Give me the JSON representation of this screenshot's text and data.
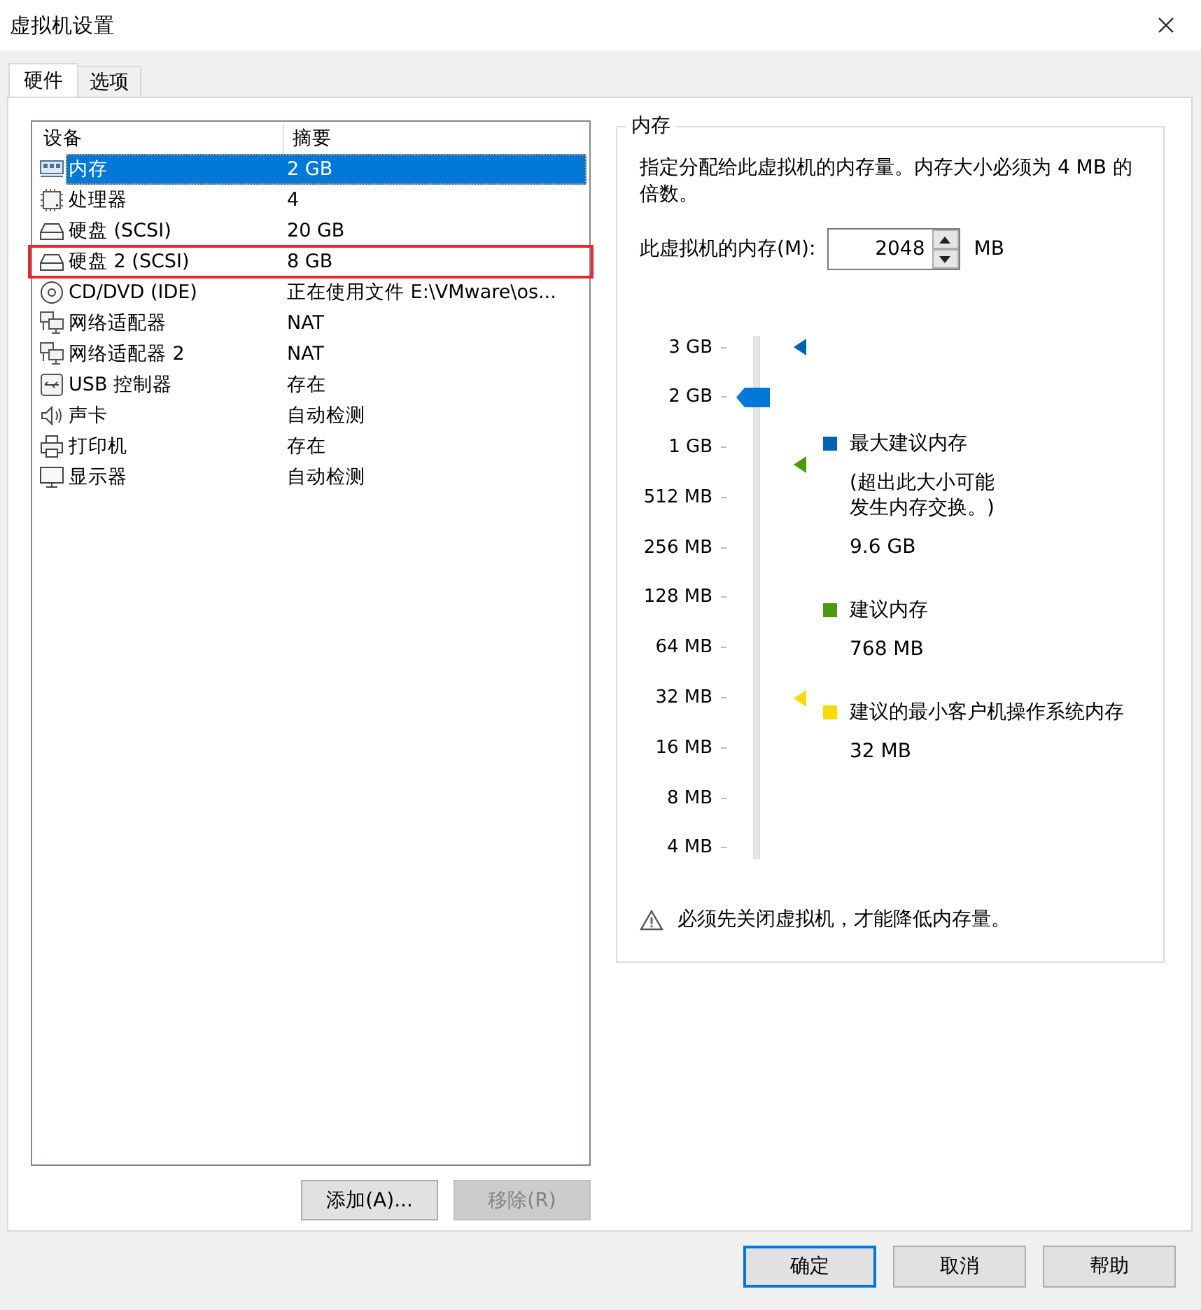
{
  "window": {
    "title": "虚拟机设置"
  },
  "tabs": [
    {
      "label": "硬件",
      "selected": true
    },
    {
      "label": "选项",
      "selected": false
    }
  ],
  "devices": {
    "columns": [
      "设备",
      "摘要"
    ],
    "rows": [
      {
        "kind": "memory",
        "name": "内存",
        "summary": "2 GB",
        "selected": true,
        "highlighted": false
      },
      {
        "kind": "cpu",
        "name": "处理器",
        "summary": "4",
        "selected": false,
        "highlighted": false
      },
      {
        "kind": "disk",
        "name": "硬盘 (SCSI)",
        "summary": "20 GB",
        "selected": false,
        "highlighted": false
      },
      {
        "kind": "disk",
        "name": "硬盘 2 (SCSI)",
        "summary": "8 GB",
        "selected": false,
        "highlighted": true
      },
      {
        "kind": "cdrom",
        "name": "CD/DVD (IDE)",
        "summary": "正在使用文件 E:\\VMware\\os...",
        "selected": false,
        "highlighted": false
      },
      {
        "kind": "network",
        "name": "网络适配器",
        "summary": "NAT",
        "selected": false,
        "highlighted": false
      },
      {
        "kind": "network",
        "name": "网络适配器 2",
        "summary": "NAT",
        "selected": false,
        "highlighted": false
      },
      {
        "kind": "usb",
        "name": "USB 控制器",
        "summary": "存在",
        "selected": false,
        "highlighted": false
      },
      {
        "kind": "sound",
        "name": "声卡",
        "summary": "自动检测",
        "selected": false,
        "highlighted": false
      },
      {
        "kind": "printer",
        "name": "打印机",
        "summary": "存在",
        "selected": false,
        "highlighted": false
      },
      {
        "kind": "display",
        "name": "显示器",
        "summary": "自动检测",
        "selected": false,
        "highlighted": false
      }
    ]
  },
  "list_buttons": [
    {
      "label": "添加(A)...",
      "disabled": false
    },
    {
      "label": "移除(R)",
      "disabled": true
    }
  ],
  "memory": {
    "title": "内存",
    "description": "指定分配给此虚拟机的内存量。内存大小必须为 4 MB 的倍数。",
    "field_label": "此虚拟机的内存(M):",
    "value": "2048",
    "unit": "MB",
    "scale": [
      "3 GB",
      "2 GB",
      "1 GB",
      "512 MB",
      "256 MB",
      "128 MB",
      "64 MB",
      "32 MB",
      "16 MB",
      "8 MB",
      "4 MB"
    ],
    "slider": {
      "level": 0.9
    },
    "legend": [
      {
        "label": "最大建议内存",
        "note": "(超出此大小可能发生内存交换。)",
        "value": "9.6 GB",
        "color": "#0063b1"
      },
      {
        "label": "建议内存",
        "value": "768 MB",
        "color": "#4a9a0c"
      },
      {
        "label": "建议的最小客户机操作系统内存",
        "value": "32 MB",
        "color": "#ffd800"
      }
    ],
    "warning": "必须先关闭虚拟机，才能降低内存量。"
  },
  "dialog_buttons": [
    {
      "label": "确定",
      "default": true
    },
    {
      "label": "取消",
      "default": false
    },
    {
      "label": "帮助",
      "default": false
    }
  ]
}
